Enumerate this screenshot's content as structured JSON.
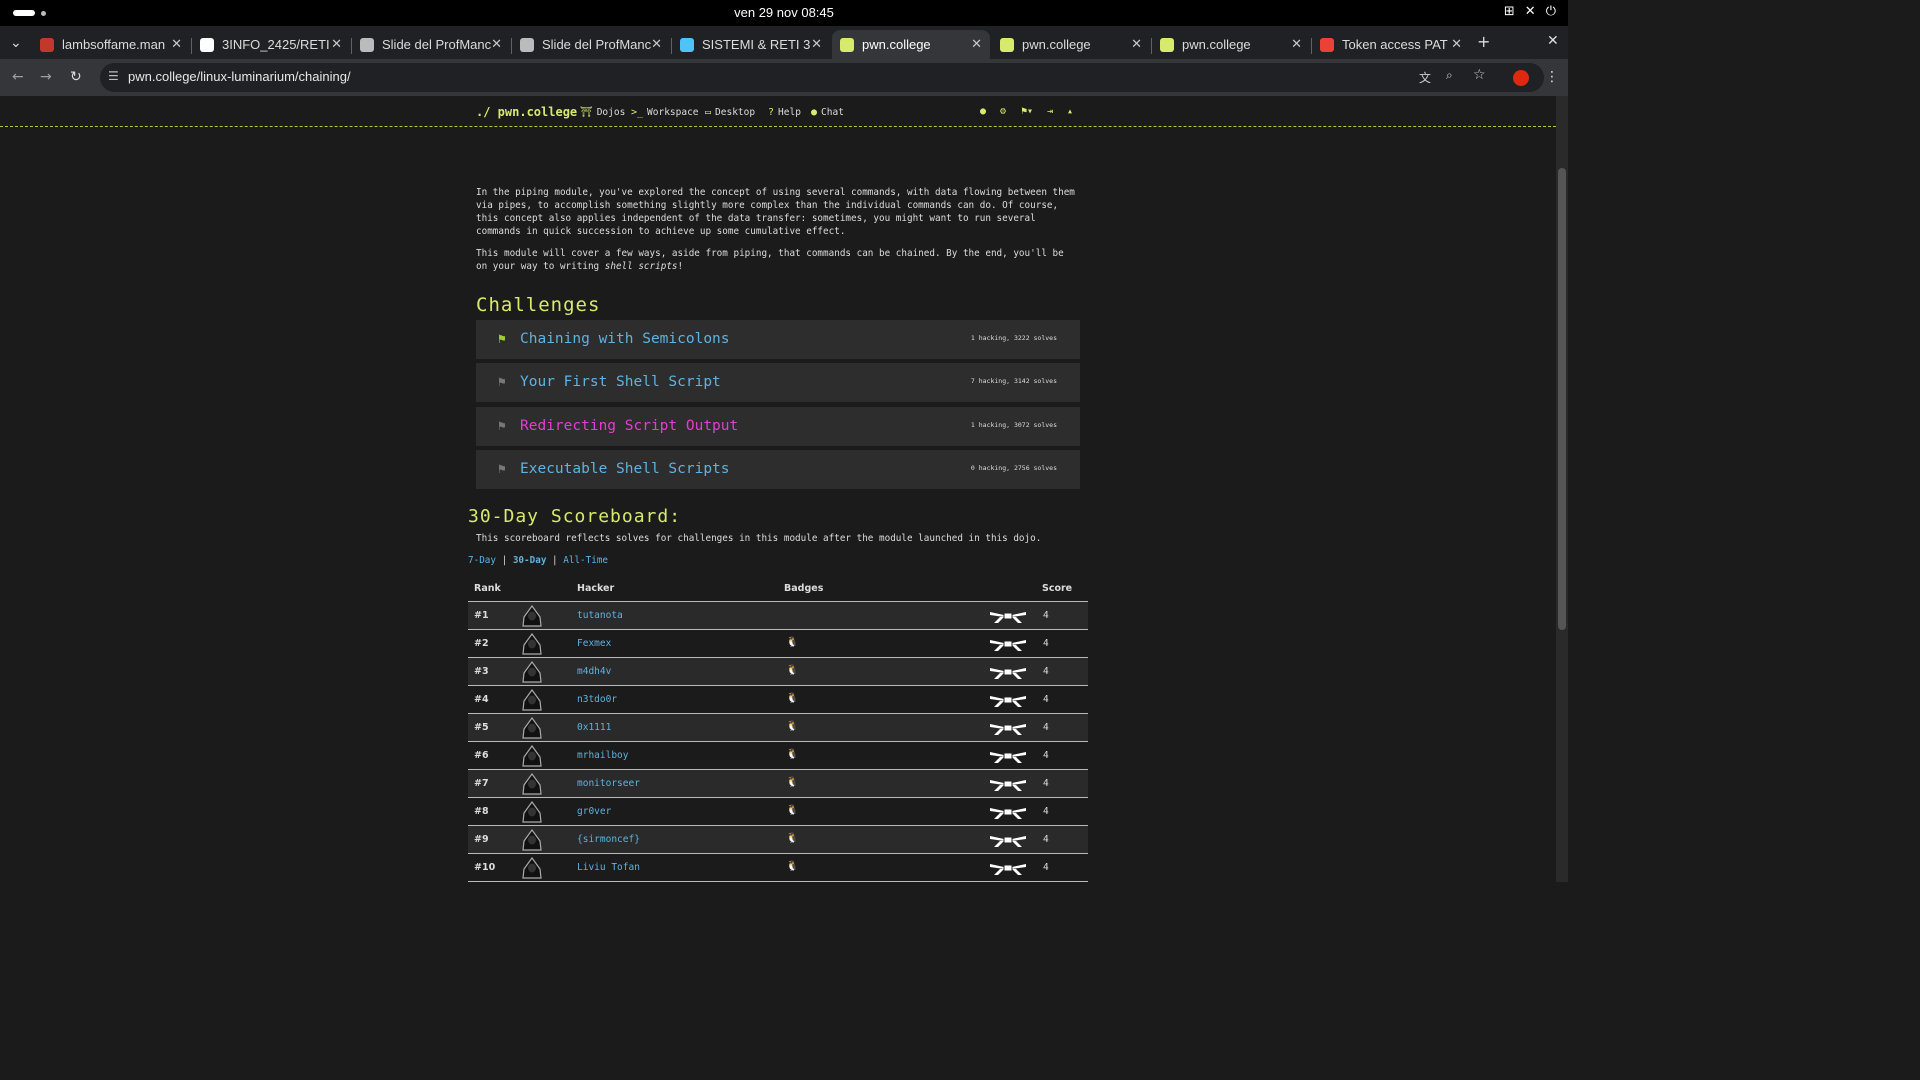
{
  "os": {
    "clock": "ven 29 nov  08:45"
  },
  "browser": {
    "tabs": [
      {
        "title": "lambsoffame.man",
        "color": "#c0392b"
      },
      {
        "title": "3INFO_2425/RETI",
        "color": "#ffffff"
      },
      {
        "title": "Slide del ProfManc",
        "color": "#bbbbbb"
      },
      {
        "title": "Slide del ProfManc",
        "color": "#bbbbbb"
      },
      {
        "title": "SISTEMI & RETI 3",
        "color": "#4fc3f7"
      },
      {
        "title": "pwn.college",
        "color": "#d8ea6d",
        "active": true
      },
      {
        "title": "pwn.college",
        "color": "#d8ea6d"
      },
      {
        "title": "pwn.college",
        "color": "#d8ea6d"
      },
      {
        "title": "Token access PAT",
        "color": "#ea4335"
      }
    ],
    "url": "pwn.college/linux-luminarium/chaining/"
  },
  "site": {
    "brand": "./ pwn.college",
    "nav": [
      "Dojos",
      "Workspace",
      "Desktop",
      "Help",
      "Chat"
    ]
  },
  "intro": {
    "p1": "In the piping module, you've explored the concept of using several commands, with data flowing between them via pipes, to accomplish something slightly more complex than the individual commands can do. Of course, this concept also applies independent of the data transfer: sometimes, you might want to run several commands in quick succession to achieve up some cumulative effect.",
    "p2a": "This module will cover a few ways, aside from piping, that commands can be chained. By the end, you'll be on your way to writing ",
    "p2em": "shell scripts",
    "p2b": "!"
  },
  "challenges_title": "Challenges",
  "challenges": [
    {
      "name": "Chaining with Semicolons",
      "stats": "1 hacking, 3222 solves",
      "solved": true,
      "color": "#5fb3e0"
    },
    {
      "name": "Your First Shell Script",
      "stats": "7 hacking, 3142 solves",
      "solved": false,
      "color": "#5fb3e0"
    },
    {
      "name": "Redirecting Script Output",
      "stats": "1 hacking, 3072 solves",
      "solved": false,
      "color": "#e040d0"
    },
    {
      "name": "Executable Shell Scripts",
      "stats": "0 hacking, 2756 solves",
      "solved": false,
      "color": "#5fb3e0"
    }
  ],
  "scoreboard": {
    "title": "30-Day Scoreboard:",
    "desc": "This scoreboard reflects solves for challenges in this module after the module launched in this dojo.",
    "periods": [
      "7-Day",
      "30-Day",
      "All-Time"
    ],
    "sep": "|",
    "headers": {
      "rank": "Rank",
      "hacker": "Hacker",
      "badges": "Badges",
      "score": "Score"
    },
    "rows": [
      {
        "rank": "#1",
        "hacker": "tutanota",
        "badge": "",
        "score": "4"
      },
      {
        "rank": "#2",
        "hacker": "Fexmex",
        "badge": "🐧",
        "score": "4"
      },
      {
        "rank": "#3",
        "hacker": "m4dh4v",
        "badge": "🐧",
        "score": "4"
      },
      {
        "rank": "#4",
        "hacker": "n3tdo0r",
        "badge": "🐧",
        "score": "4"
      },
      {
        "rank": "#5",
        "hacker": "0x1111",
        "badge": "🐧",
        "score": "4"
      },
      {
        "rank": "#6",
        "hacker": "mrhailboy",
        "badge": "🐧",
        "score": "4"
      },
      {
        "rank": "#7",
        "hacker": "monitorseer",
        "badge": "🐧",
        "score": "4"
      },
      {
        "rank": "#8",
        "hacker": "gr0ver",
        "badge": "🐧",
        "score": "4"
      },
      {
        "rank": "#9",
        "hacker": "{sirmoncef}",
        "badge": "🐧",
        "score": "4"
      },
      {
        "rank": "#10",
        "hacker": "Liviu Tofan",
        "badge": "🐧",
        "score": "4"
      }
    ]
  }
}
